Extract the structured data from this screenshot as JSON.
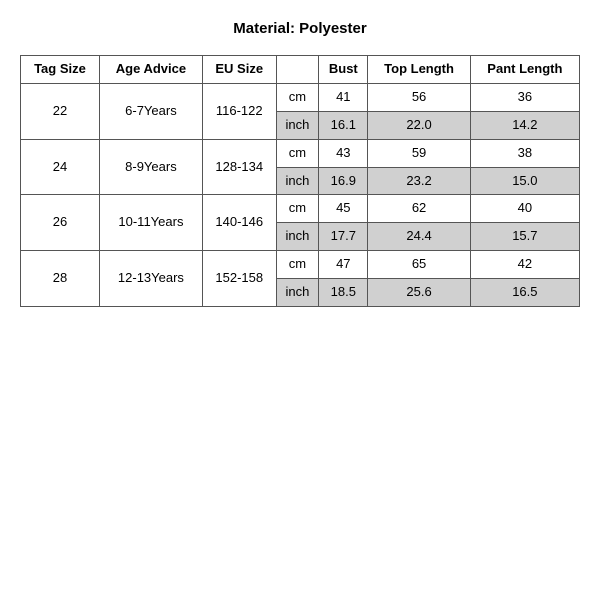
{
  "title": "Material: Polyester",
  "headers": {
    "tag_size": "Tag Size",
    "age_advice": "Age Advice",
    "eu_size": "EU Size",
    "unit": "",
    "bust": "Bust",
    "top_length": "Top Length",
    "pant_length": "Pant Length"
  },
  "rows": [
    {
      "tag_size": "22",
      "age_advice": "6-7Years",
      "eu_size": "116-122",
      "cm": {
        "unit": "cm",
        "bust": "41",
        "top_length": "56",
        "pant_length": "36"
      },
      "inch": {
        "unit": "inch",
        "bust": "16.1",
        "top_length": "22.0",
        "pant_length": "14.2"
      }
    },
    {
      "tag_size": "24",
      "age_advice": "8-9Years",
      "eu_size": "128-134",
      "cm": {
        "unit": "cm",
        "bust": "43",
        "top_length": "59",
        "pant_length": "38"
      },
      "inch": {
        "unit": "inch",
        "bust": "16.9",
        "top_length": "23.2",
        "pant_length": "15.0"
      }
    },
    {
      "tag_size": "26",
      "age_advice": "10-11Years",
      "eu_size": "140-146",
      "cm": {
        "unit": "cm",
        "bust": "45",
        "top_length": "62",
        "pant_length": "40"
      },
      "inch": {
        "unit": "inch",
        "bust": "17.7",
        "top_length": "24.4",
        "pant_length": "15.7"
      }
    },
    {
      "tag_size": "28",
      "age_advice": "12-13Years",
      "eu_size": "152-158",
      "cm": {
        "unit": "cm",
        "bust": "47",
        "top_length": "65",
        "pant_length": "42"
      },
      "inch": {
        "unit": "inch",
        "bust": "18.5",
        "top_length": "25.6",
        "pant_length": "16.5"
      }
    }
  ]
}
